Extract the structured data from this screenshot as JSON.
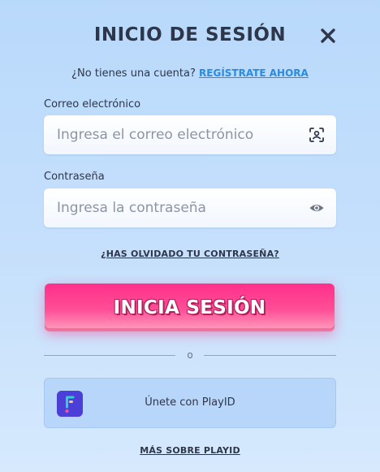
{
  "dialog": {
    "title": "INICIO DE SESIÓN",
    "close_icon": "close-icon"
  },
  "signup": {
    "prompt": "¿No tienes una cuenta?",
    "link": "REGÍSTRATE AHORA",
    "link_color": "#2a8be0"
  },
  "email": {
    "label": "Correo electrónico",
    "placeholder": "Ingresa el correo electrónico",
    "value": "",
    "icon": "face-scan-icon"
  },
  "password": {
    "label": "Contraseña",
    "placeholder": "Ingresa la contraseña",
    "value": "",
    "icon": "eye-icon"
  },
  "forgot_password": "¿HAS OLVIDADO TU CONTRASEÑA?",
  "login_button": {
    "label": "INICIA SESIÓN",
    "color": "#ff3d8f"
  },
  "divider_text": "o",
  "playid": {
    "label": "Únete con PlayID",
    "logo": "playid-logo-icon",
    "more_link": "MÁS SOBRE PLAYID"
  }
}
